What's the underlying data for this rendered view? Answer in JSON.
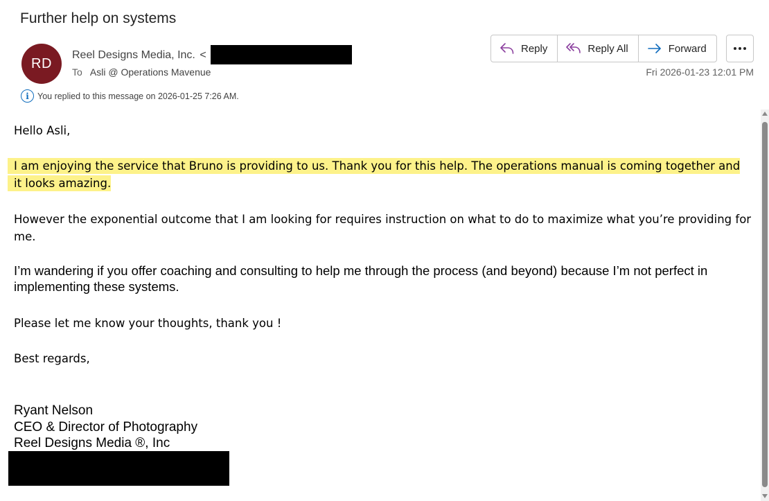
{
  "email": {
    "subject": "Further help on systems",
    "sender_initials": "RD",
    "sender_name": "Reel Designs Media, Inc.",
    "sender_email_open": "<",
    "to_label": "To",
    "to_value": "Asli @ Operations Mavenue",
    "info_text": "You replied to this message on 2026-01-25 7:26 AM.",
    "date": "Fri 2026-01-23 12:01 PM"
  },
  "actions": {
    "reply": "Reply",
    "reply_all": "Reply All",
    "forward": "Forward"
  },
  "body": {
    "greeting": "Hello Asli,",
    "para1_line1": "I am enjoying the service that Bruno is providing to us. Thank you for this help. The operations manual is coming together and",
    "para1_line2": "it looks amazing.",
    "para2": "However the exponential outcome that I am looking for requires instruction on what to do to maximize what you’re providing for me.",
    "para3": "I’m wandering if you offer coaching and consulting to help me through the process (and beyond) because I’m not perfect in implementing these systems.",
    "para4": "Please let me know your thoughts, thank you !",
    "closing": "Best regards,",
    "sig_name": "Ryant Nelson",
    "sig_title": "CEO & Director of Photography",
    "sig_company": "Reel Designs Media ®, Inc"
  },
  "colors": {
    "avatar_bg": "#7a1a22",
    "highlight": "#fdf28a",
    "reply_icon": "#8b3f9e",
    "forward_icon": "#0f6cbd",
    "info_icon": "#0f6cbd"
  },
  "icons": {
    "reply": "reply-icon",
    "reply_all": "reply-all-icon",
    "forward": "forward-icon",
    "more": "more-options-icon",
    "info": "info-icon"
  }
}
